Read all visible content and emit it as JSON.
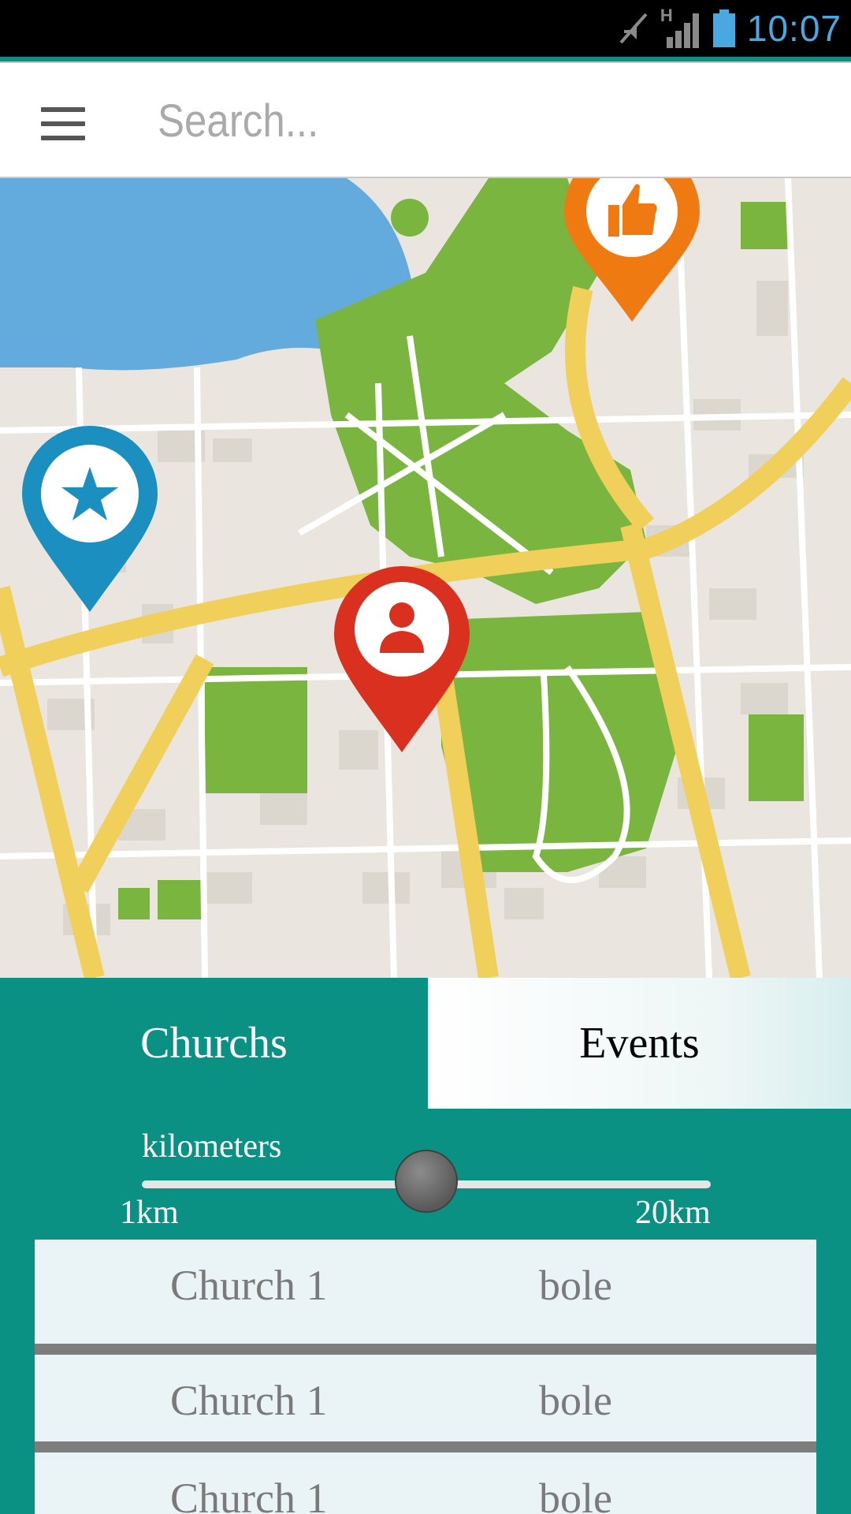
{
  "status_bar": {
    "time": "10:07",
    "network_label": "H",
    "icons": [
      "mute-icon",
      "signal-icon",
      "battery-icon"
    ],
    "time_color": "#4aa8e0"
  },
  "search": {
    "placeholder": "Search...",
    "value": ""
  },
  "map": {
    "markers": [
      {
        "name": "thumbs-up-marker",
        "icon": "thumbs-up-icon",
        "color": "#f07a12"
      },
      {
        "name": "star-marker",
        "icon": "star-icon",
        "color": "#1b8fbf"
      },
      {
        "name": "person-marker",
        "icon": "person-icon",
        "color": "#d93020"
      }
    ],
    "colors": {
      "water": "#62abdc",
      "park": "#7ab53f",
      "road": "#f0cf5a",
      "land": "#eae6df"
    }
  },
  "tabs": [
    {
      "label": "Churchs",
      "active": true
    },
    {
      "label": "Events",
      "active": false
    }
  ],
  "distance_slider": {
    "label": "kilometers",
    "min_label": "1km",
    "max_label": "20km",
    "value_fraction": 0.5
  },
  "churches": [
    {
      "name": "Church 1",
      "location": "bole"
    },
    {
      "name": "Church 1",
      "location": "bole"
    },
    {
      "name": "Church 1",
      "location": "bole"
    }
  ],
  "accent_color": "#0a9183"
}
